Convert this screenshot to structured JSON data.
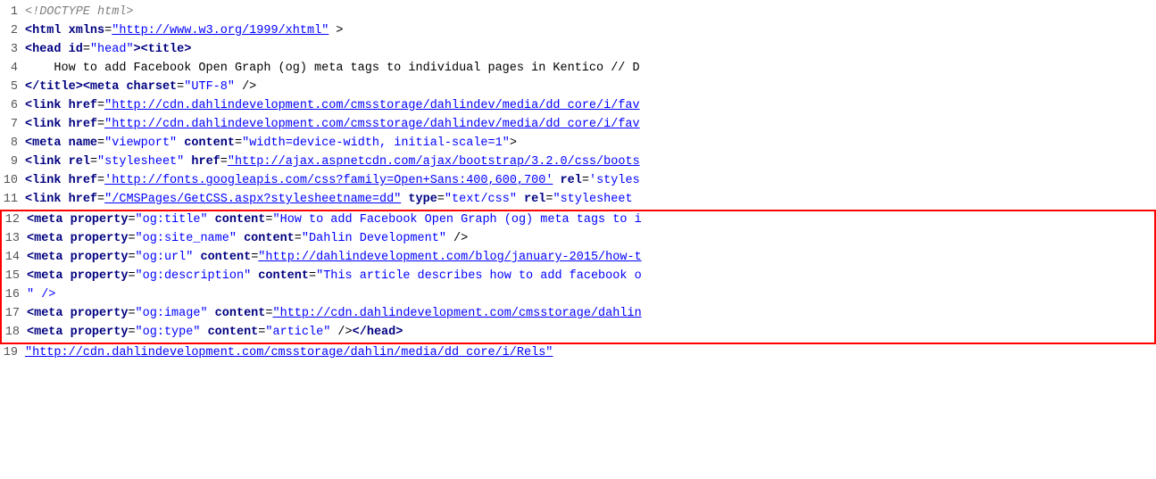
{
  "lines": [
    {
      "num": 1,
      "highlighted": false,
      "parts": [
        {
          "type": "comment",
          "text": "<!DOCTYPE html>"
        }
      ]
    },
    {
      "num": 2,
      "highlighted": false,
      "parts": [
        {
          "type": "tag",
          "text": "<html"
        },
        {
          "type": "text",
          "text": " "
        },
        {
          "type": "attr",
          "text": "xmlns"
        },
        {
          "type": "text",
          "text": "="
        },
        {
          "type": "value",
          "text": "\"http://www.w3.org/1999/xhtml\""
        },
        {
          "type": "text",
          "text": " >"
        }
      ]
    },
    {
      "num": 3,
      "highlighted": false,
      "parts": [
        {
          "type": "tag",
          "text": "<head"
        },
        {
          "type": "text",
          "text": " "
        },
        {
          "type": "attr",
          "text": "id"
        },
        {
          "type": "text",
          "text": "="
        },
        {
          "type": "value-plain",
          "text": "\"head\""
        },
        {
          "type": "tag",
          "text": "><title>"
        }
      ]
    },
    {
      "num": 4,
      "highlighted": false,
      "parts": [
        {
          "type": "text",
          "text": "    How to add Facebook Open Graph (og) meta tags to individual pages in Kentico // D"
        }
      ]
    },
    {
      "num": 5,
      "highlighted": false,
      "parts": [
        {
          "type": "tag",
          "text": "</title>"
        },
        {
          "type": "tag",
          "text": "<meta"
        },
        {
          "type": "text",
          "text": " "
        },
        {
          "type": "attr",
          "text": "charset"
        },
        {
          "type": "text",
          "text": "="
        },
        {
          "type": "value-plain",
          "text": "\"UTF-8\""
        },
        {
          "type": "text",
          "text": " />"
        }
      ]
    },
    {
      "num": 6,
      "highlighted": false,
      "parts": [
        {
          "type": "tag",
          "text": "<link"
        },
        {
          "type": "text",
          "text": " "
        },
        {
          "type": "attr",
          "text": "href"
        },
        {
          "type": "text",
          "text": "="
        },
        {
          "type": "value",
          "text": "\"http://cdn.dahlindevelopment.com/cmsstorage/dahlindev/media/dd_core/i/fav"
        }
      ]
    },
    {
      "num": 7,
      "highlighted": false,
      "parts": [
        {
          "type": "tag",
          "text": "<link"
        },
        {
          "type": "text",
          "text": " "
        },
        {
          "type": "attr",
          "text": "href"
        },
        {
          "type": "text",
          "text": "="
        },
        {
          "type": "value",
          "text": "\"http://cdn.dahlindevelopment.com/cmsstorage/dahlindev/media/dd_core/i/fav"
        }
      ]
    },
    {
      "num": 8,
      "highlighted": false,
      "parts": [
        {
          "type": "tag",
          "text": "<meta"
        },
        {
          "type": "text",
          "text": " "
        },
        {
          "type": "attr",
          "text": "name"
        },
        {
          "type": "text",
          "text": "="
        },
        {
          "type": "value-plain",
          "text": "\"viewport\""
        },
        {
          "type": "text",
          "text": " "
        },
        {
          "type": "attr",
          "text": "content"
        },
        {
          "type": "text",
          "text": "="
        },
        {
          "type": "value-plain",
          "text": "\"width=device-width, initial-scale=1\""
        },
        {
          "type": "text",
          "text": ">"
        }
      ]
    },
    {
      "num": 9,
      "highlighted": false,
      "parts": [
        {
          "type": "tag",
          "text": "<link"
        },
        {
          "type": "text",
          "text": " "
        },
        {
          "type": "attr",
          "text": "rel"
        },
        {
          "type": "text",
          "text": "="
        },
        {
          "type": "value-plain",
          "text": "\"stylesheet\""
        },
        {
          "type": "text",
          "text": " "
        },
        {
          "type": "attr",
          "text": "href"
        },
        {
          "type": "text",
          "text": "="
        },
        {
          "type": "value",
          "text": "\"http://ajax.aspnetcdn.com/ajax/bootstrap/3.2.0/css/boots"
        }
      ]
    },
    {
      "num": 10,
      "highlighted": false,
      "parts": [
        {
          "type": "tag",
          "text": "<link"
        },
        {
          "type": "text",
          "text": " "
        },
        {
          "type": "attr",
          "text": "href"
        },
        {
          "type": "text",
          "text": "="
        },
        {
          "type": "value",
          "text": "'http://fonts.googleapis.com/css?family=Open+Sans:400,600,700'"
        },
        {
          "type": "text",
          "text": " "
        },
        {
          "type": "attr",
          "text": "rel"
        },
        {
          "type": "text",
          "text": "="
        },
        {
          "type": "value-plain",
          "text": "'styles"
        }
      ]
    },
    {
      "num": 11,
      "highlighted": false,
      "parts": [
        {
          "type": "tag",
          "text": "<link"
        },
        {
          "type": "text",
          "text": " "
        },
        {
          "type": "attr",
          "text": "href"
        },
        {
          "type": "text",
          "text": "="
        },
        {
          "type": "value",
          "text": "\"/CMSPages/GetCSS.aspx?stylesheetname=dd\""
        },
        {
          "type": "text",
          "text": " "
        },
        {
          "type": "attr",
          "text": "type"
        },
        {
          "type": "text",
          "text": "="
        },
        {
          "type": "value-plain",
          "text": "\"text/css\""
        },
        {
          "type": "text",
          "text": " "
        },
        {
          "type": "attr",
          "text": "rel"
        },
        {
          "type": "text",
          "text": "="
        },
        {
          "type": "value-plain",
          "text": "\"stylesheet"
        }
      ]
    },
    {
      "num": 12,
      "highlighted": true,
      "parts": [
        {
          "type": "tag",
          "text": "<meta"
        },
        {
          "type": "text",
          "text": " "
        },
        {
          "type": "attr",
          "text": "property"
        },
        {
          "type": "text",
          "text": "="
        },
        {
          "type": "value-plain",
          "text": "\"og:title\""
        },
        {
          "type": "text",
          "text": " "
        },
        {
          "type": "attr",
          "text": "content"
        },
        {
          "type": "text",
          "text": "="
        },
        {
          "type": "value-plain",
          "text": "\"How to add Facebook Open Graph (og) meta tags to i"
        }
      ]
    },
    {
      "num": 13,
      "highlighted": true,
      "parts": [
        {
          "type": "tag",
          "text": "<meta"
        },
        {
          "type": "text",
          "text": " "
        },
        {
          "type": "attr",
          "text": "property"
        },
        {
          "type": "text",
          "text": "="
        },
        {
          "type": "value-plain",
          "text": "\"og:site_name\""
        },
        {
          "type": "text",
          "text": " "
        },
        {
          "type": "attr",
          "text": "content"
        },
        {
          "type": "text",
          "text": "="
        },
        {
          "type": "value-plain",
          "text": "\"Dahlin Development\""
        },
        {
          "type": "text",
          "text": " />"
        }
      ]
    },
    {
      "num": 14,
      "highlighted": true,
      "parts": [
        {
          "type": "tag",
          "text": "<meta"
        },
        {
          "type": "text",
          "text": " "
        },
        {
          "type": "attr",
          "text": "property"
        },
        {
          "type": "text",
          "text": "="
        },
        {
          "type": "value-plain",
          "text": "\"og:url\""
        },
        {
          "type": "text",
          "text": " "
        },
        {
          "type": "attr",
          "text": "content"
        },
        {
          "type": "text",
          "text": "="
        },
        {
          "type": "value",
          "text": "\"http://dahlindevelopment.com/blog/january-2015/how-t"
        }
      ]
    },
    {
      "num": 15,
      "highlighted": true,
      "parts": [
        {
          "type": "tag",
          "text": "<meta"
        },
        {
          "type": "text",
          "text": " "
        },
        {
          "type": "attr",
          "text": "property"
        },
        {
          "type": "text",
          "text": "="
        },
        {
          "type": "value-plain",
          "text": "\"og:description\""
        },
        {
          "type": "text",
          "text": " "
        },
        {
          "type": "attr",
          "text": "content"
        },
        {
          "type": "text",
          "text": "="
        },
        {
          "type": "value-plain",
          "text": "\"This article describes how to add facebook o"
        }
      ]
    },
    {
      "num": 16,
      "highlighted": true,
      "parts": [
        {
          "type": "value-plain",
          "text": "\" />"
        }
      ]
    },
    {
      "num": 17,
      "highlighted": true,
      "parts": [
        {
          "type": "tag",
          "text": "<meta"
        },
        {
          "type": "text",
          "text": " "
        },
        {
          "type": "attr",
          "text": "property"
        },
        {
          "type": "text",
          "text": "="
        },
        {
          "type": "value-plain",
          "text": "\"og:image\""
        },
        {
          "type": "text",
          "text": " "
        },
        {
          "type": "attr",
          "text": "content"
        },
        {
          "type": "text",
          "text": "="
        },
        {
          "type": "value",
          "text": "\"http://cdn.dahlindevelopment.com/cmsstorage/dahlin"
        }
      ]
    },
    {
      "num": 18,
      "highlighted": true,
      "parts": [
        {
          "type": "tag",
          "text": "<meta"
        },
        {
          "type": "text",
          "text": " "
        },
        {
          "type": "attr",
          "text": "property"
        },
        {
          "type": "text",
          "text": "="
        },
        {
          "type": "value-plain",
          "text": "\"og:type\""
        },
        {
          "type": "text",
          "text": " "
        },
        {
          "type": "attr",
          "text": "content"
        },
        {
          "type": "text",
          "text": "="
        },
        {
          "type": "value-plain",
          "text": "\"article\""
        },
        {
          "type": "text",
          "text": " />"
        },
        {
          "type": "tag",
          "text": "</head>"
        }
      ]
    },
    {
      "num": 19,
      "highlighted": false,
      "parts": [
        {
          "type": "value",
          "text": "\"http://cdn.dahlindevelopment.com/cmsstorage/dahlin/media/dd_core/i/Rels\""
        }
      ]
    }
  ]
}
